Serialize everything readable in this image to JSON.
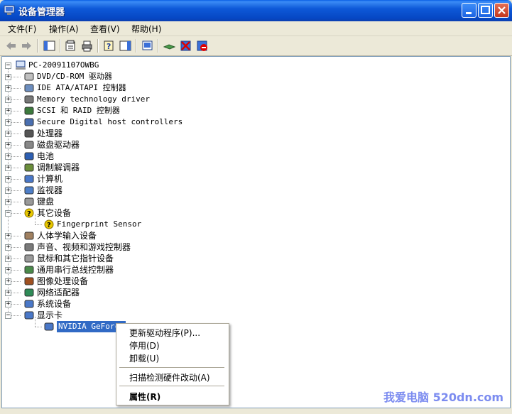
{
  "window": {
    "title": "设备管理器"
  },
  "menu": [
    "文件(F)",
    "操作(A)",
    "查看(V)",
    "帮助(H)"
  ],
  "tree": {
    "root": "PC-20091107OWBG",
    "categories": [
      "DVD/CD-ROM 驱动器",
      "IDE ATA/ATAPI 控制器",
      "Memory technology driver",
      "SCSI 和 RAID 控制器",
      "Secure Digital host controllers",
      "处理器",
      "磁盘驱动器",
      "电池",
      "调制解调器",
      "计算机",
      "监视器",
      "键盘",
      "其它设备",
      "Fingerprint Sensor",
      "人体学输入设备",
      "声音、视频和游戏控制器",
      "鼠标和其它指针设备",
      "通用串行总线控制器",
      "图像处理设备",
      "网络适配器",
      "系统设备",
      "显示卡",
      "NVIDIA GeForce"
    ]
  },
  "context_menu": {
    "update_driver": "更新驱动程序(P)...",
    "disable": "停用(D)",
    "uninstall": "卸载(U)",
    "scan": "扫描检测硬件改动(A)",
    "properties": "属性(R)"
  },
  "watermark": "我爱电脑 520dn.com",
  "colors": {
    "titlebar": "#0A5FE6",
    "selection": "#316AC5",
    "window_bg": "#ECE9D8"
  }
}
